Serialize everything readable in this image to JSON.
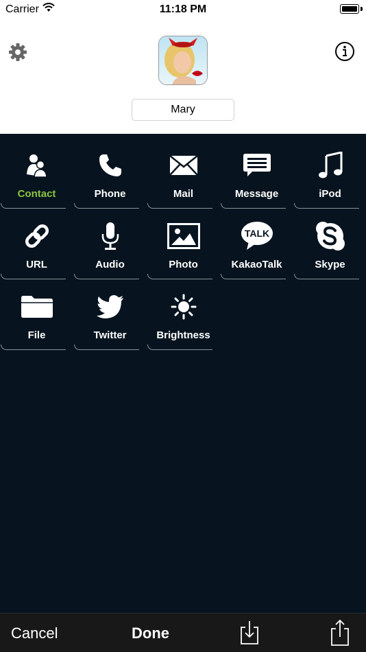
{
  "status_bar": {
    "carrier": "Carrier",
    "time": "11:18 PM"
  },
  "header": {
    "name_value": "Mary"
  },
  "grid": {
    "items": [
      {
        "label": "Contact",
        "icon": "contact-icon",
        "selected": true
      },
      {
        "label": "Phone",
        "icon": "phone-icon"
      },
      {
        "label": "Mail",
        "icon": "mail-icon"
      },
      {
        "label": "Message",
        "icon": "message-icon"
      },
      {
        "label": "iPod",
        "icon": "music-note-icon"
      },
      {
        "label": "URL",
        "icon": "link-icon"
      },
      {
        "label": "Audio",
        "icon": "microphone-icon"
      },
      {
        "label": "Photo",
        "icon": "photo-icon"
      },
      {
        "label": "KakaoTalk",
        "icon": "kakaotalk-icon",
        "icon_text": "TALK"
      },
      {
        "label": "Skype",
        "icon": "skype-icon"
      },
      {
        "label": "File",
        "icon": "folder-icon"
      },
      {
        "label": "Twitter",
        "icon": "twitter-bird-icon"
      },
      {
        "label": "Brightness",
        "icon": "sun-icon"
      }
    ]
  },
  "toolbar": {
    "cancel_label": "Cancel",
    "done_label": "Done"
  },
  "colors": {
    "background": "#07141f",
    "selected_label": "#8cc63f",
    "toolbar": "#181818"
  }
}
